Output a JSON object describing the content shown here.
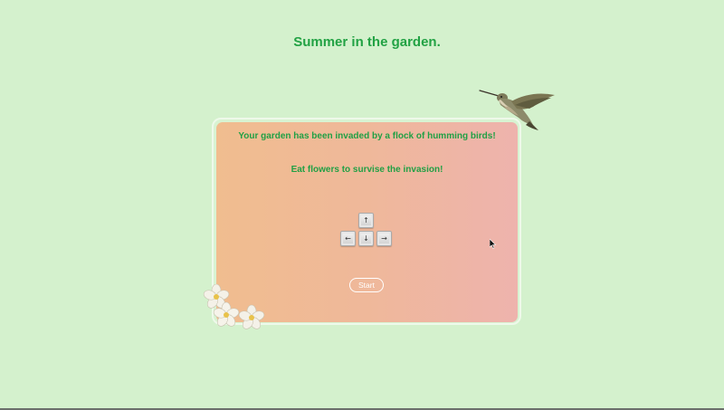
{
  "page": {
    "title": "Summer in the garden."
  },
  "panel": {
    "message_1": "Your garden has been invaded by a flock of humming birds!",
    "message_2": "Eat flowers to survise the invasion!"
  },
  "controls": {
    "keys": [
      {
        "name": "up",
        "glyph": "↑"
      },
      {
        "name": "left",
        "glyph": "←"
      },
      {
        "name": "down",
        "glyph": "↓"
      },
      {
        "name": "right",
        "glyph": "→"
      }
    ]
  },
  "start_button": {
    "label": "Start"
  },
  "icons": {
    "bird": "hummingbird-icon",
    "flowers": "flowers-icon",
    "cursor": "mouse-cursor-icon"
  },
  "colors": {
    "background": "#d4f1cd",
    "title_text": "#22a244",
    "card_gradient_start": "#f0bd8f",
    "card_gradient_end": "#eeb3ad",
    "button_border": "#ffffff"
  }
}
